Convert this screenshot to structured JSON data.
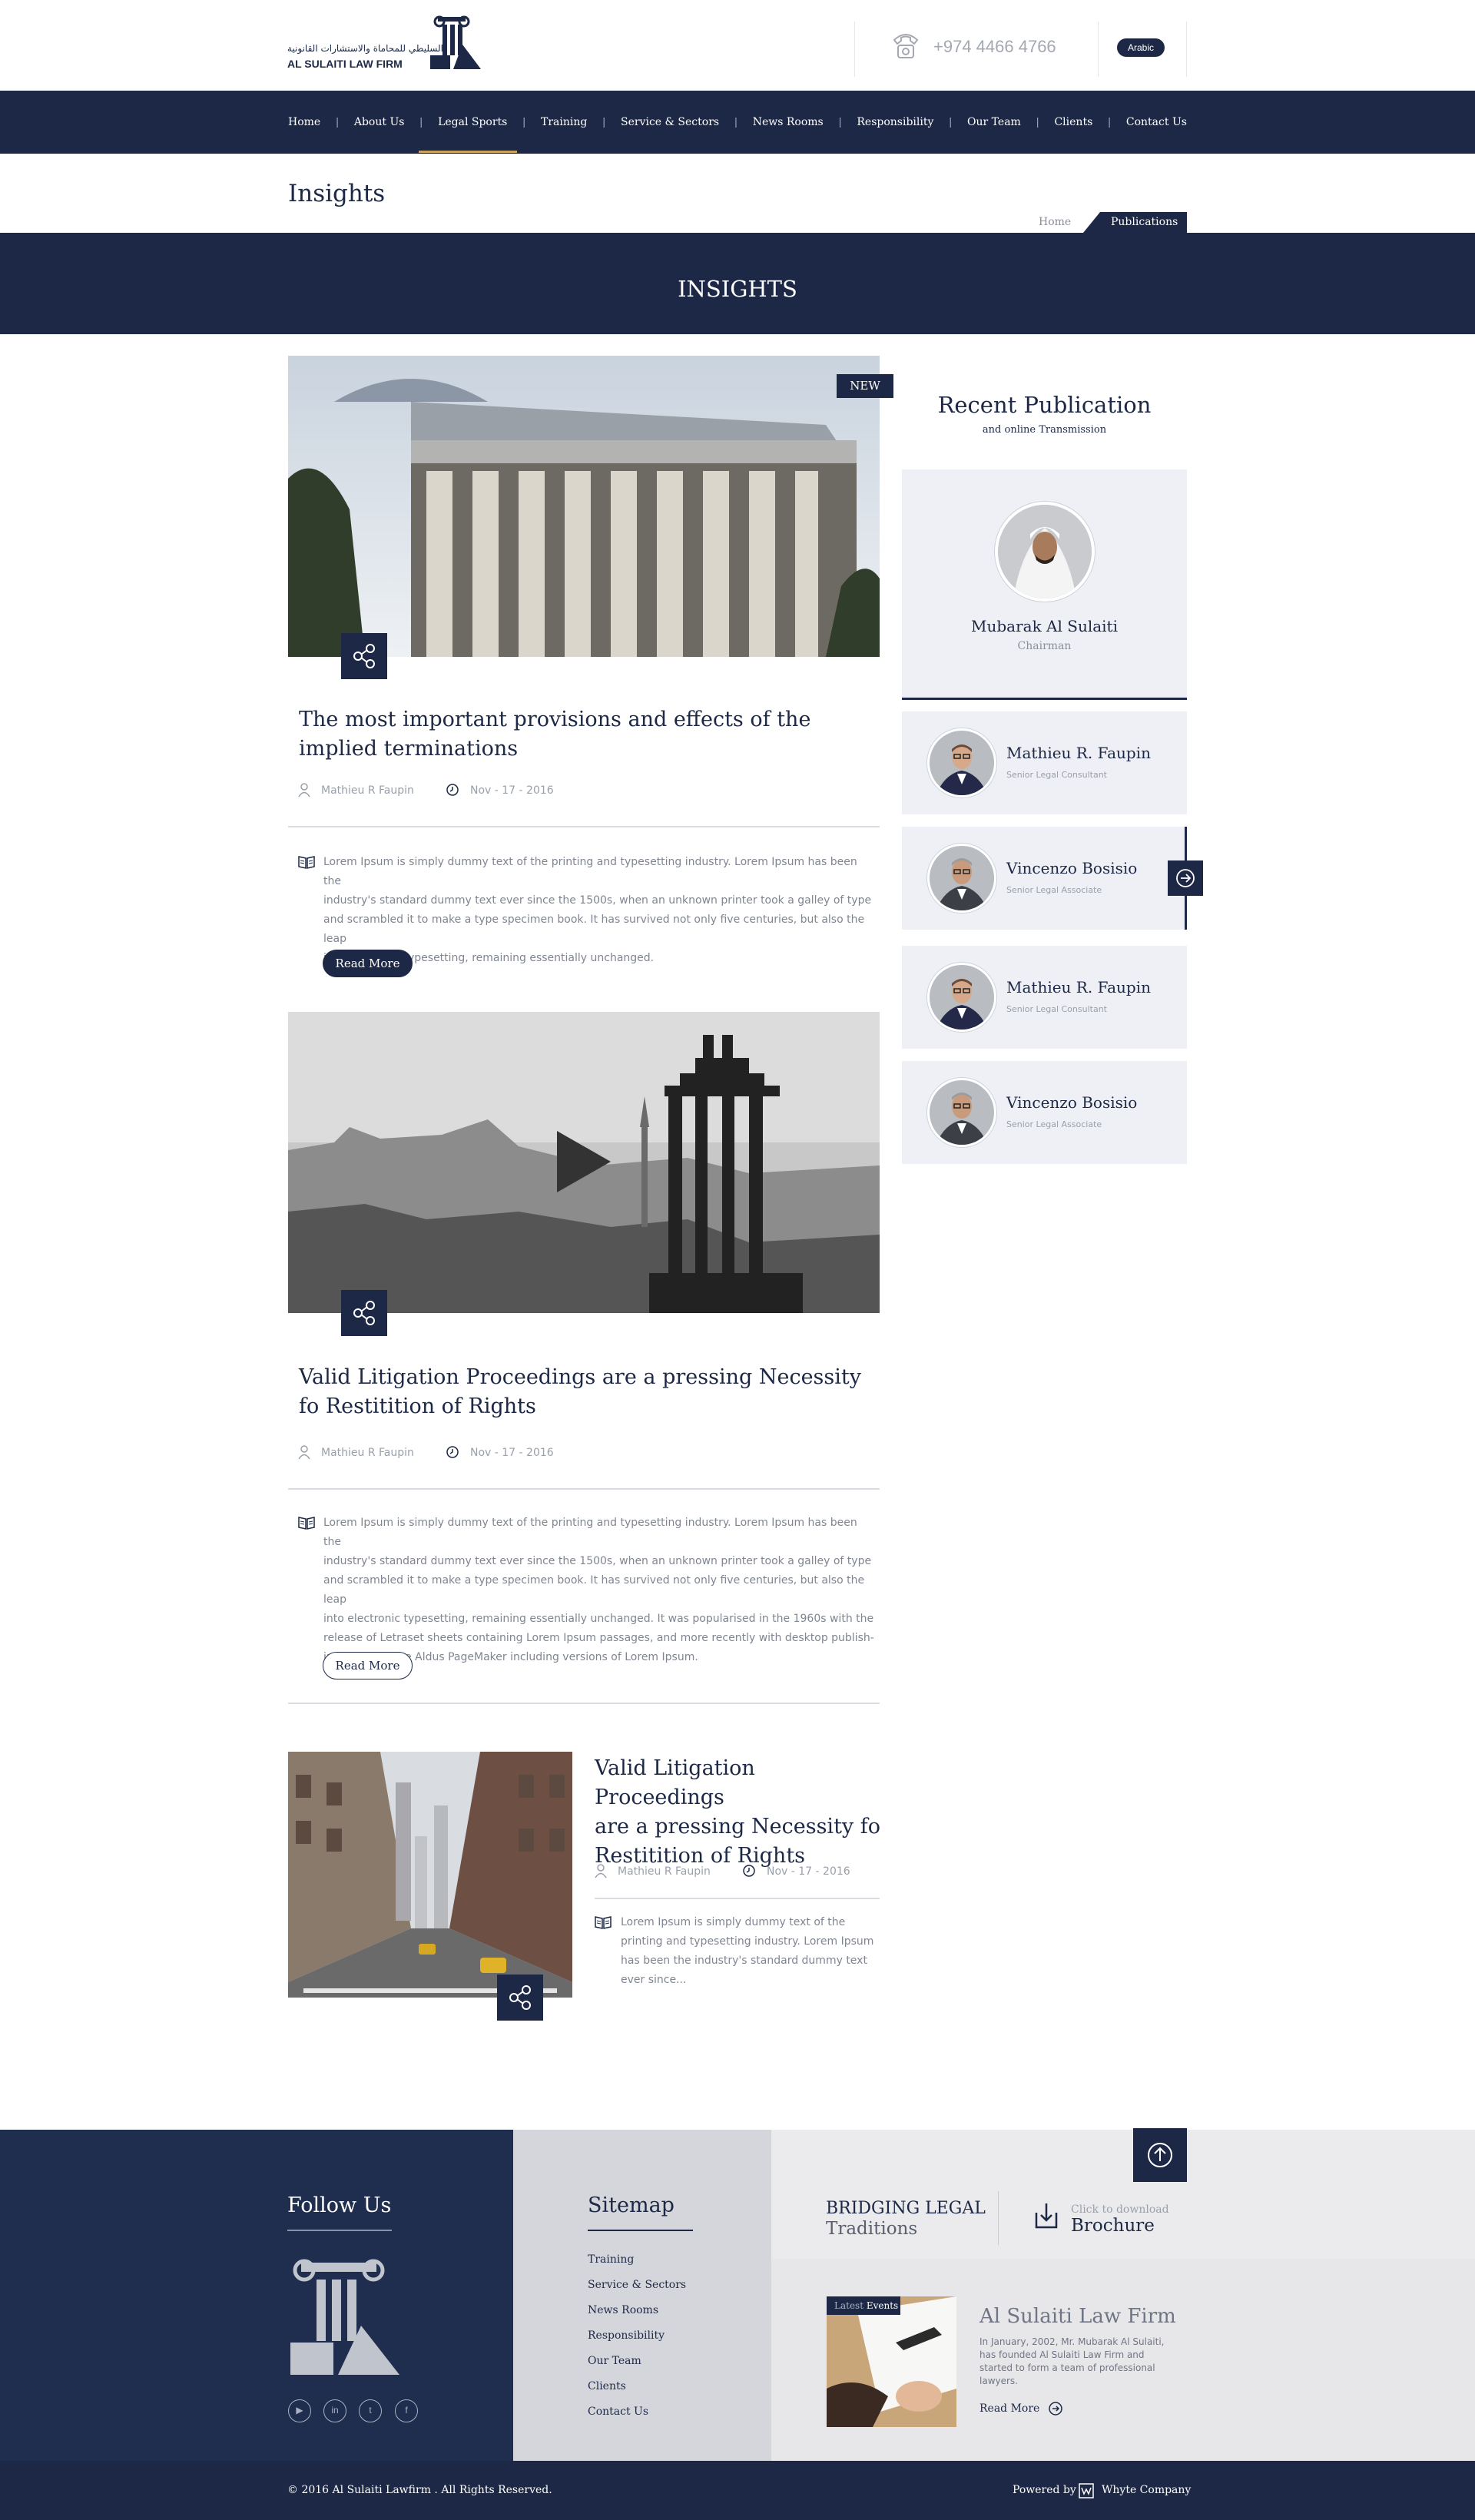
{
  "header": {
    "logo_arabic": "السليطي للمحاماة والاستشارات القانونية",
    "logo_name": "AL SULAITI LAW FIRM",
    "phone": "+974 4466 4766",
    "language_button": "Arabic"
  },
  "nav": {
    "items": [
      {
        "label": "Home"
      },
      {
        "label": "About Us"
      },
      {
        "label": "Legal Sports",
        "active": true
      },
      {
        "label": "Training"
      },
      {
        "label": "Service & Sectors"
      },
      {
        "label": "News Rooms"
      },
      {
        "label": "Responsibility"
      },
      {
        "label": "Our Team"
      },
      {
        "label": "Clients"
      },
      {
        "label": "Contact Us"
      }
    ],
    "separator": "|"
  },
  "page": {
    "title": "Insights",
    "breadcrumb": {
      "home": "Home",
      "current": "Publications"
    },
    "banner": "INSIGHTS"
  },
  "articles": [
    {
      "badge": "NEW",
      "title": "The most important provisions and effects of the implied terminations",
      "author": "Mathieu R Faupin",
      "date": "Nov - 17 - 2016",
      "body": [
        "Lorem Ipsum is simply dummy text of the printing and typesetting industry. Lorem Ipsum has been the",
        "industry's standard dummy text ever since the 1500s, when an unknown printer took a galley of type",
        "and scrambled it to make a type specimen book. It has survived not only five centuries, but also the leap",
        "into electronic typesetting, remaining essentially unchanged."
      ],
      "read_more": "Read More"
    },
    {
      "title": "Valid Litigation Proceedings are a pressing Necessity fo Restitition of Rights",
      "author": "Mathieu R Faupin",
      "date": "Nov - 17 - 2016",
      "body": [
        "Lorem Ipsum is simply dummy text of the printing and typesetting industry. Lorem Ipsum has been the",
        "industry's standard dummy text ever since the 1500s, when an unknown printer took a galley of type",
        "and scrambled it to make a type specimen book. It has survived not only five centuries, but also the leap",
        "into electronic typesetting, remaining essentially unchanged. It was popularised in the 1960s with the",
        "release of Letraset sheets containing Lorem Ipsum passages, and more recently with desktop publish-",
        "ing software like Aldus PageMaker including versions of Lorem Ipsum."
      ],
      "read_more": "Read More"
    },
    {
      "title_lines": [
        "Valid Litigation Proceedings",
        "are a pressing Necessity fo",
        "Restitition of Rights"
      ],
      "author": "Mathieu R Faupin",
      "date": "Nov - 17 - 2016",
      "body": [
        "Lorem Ipsum is simply dummy text of the",
        "printing and typesetting industry. Lorem Ipsum",
        "has been the industry's standard dummy text",
        "ever since..."
      ]
    }
  ],
  "sidebar": {
    "title": "Recent Publication",
    "subtitle": "and online Transmission",
    "chairman": {
      "name": "Mubarak Al Sulaiti",
      "role": "Chairman"
    },
    "members": [
      {
        "name": "Mathieu R. Faupin",
        "role": "Senior Legal Consultant"
      },
      {
        "name": "Vincenzo Bosisio",
        "role": "Senior Legal Associate"
      },
      {
        "name": "Mathieu R. Faupin",
        "role": "Senior Legal Consultant"
      },
      {
        "name": "Vincenzo Bosisio",
        "role": "Senior Legal Associate"
      }
    ]
  },
  "footer": {
    "follow_title": "Follow Us",
    "social": [
      "youtube-icon",
      "linkedin-icon",
      "twitter-icon",
      "facebook-icon"
    ],
    "sitemap_title": "Sitemap",
    "sitemap_links": [
      "Training",
      "Service & Sectors",
      "News Rooms",
      "Responsibility",
      "Our Team",
      "Clients",
      "Contact Us"
    ],
    "bridging_line1": "BRIDGING LEGAL",
    "bridging_line2": "Traditions",
    "download_small": "Click to download",
    "download_big": "Brochure",
    "event_badge_a": "Latest",
    "event_badge_b": "Events",
    "event_title": "Al Sulaiti Law Firm",
    "event_text": "In January, 2002, Mr. Mubarak Al Sulaiti, has founded Al Sulaiti Law Firm and started to form a team of professional lawyers.",
    "event_more": "Read More",
    "copyright": "© 2016 Al Sulaiti Lawfirm . All Rights Reserved.",
    "powered": "Powered by",
    "company": "Whyte Company"
  },
  "colors": {
    "navy": "#1c2845",
    "gold": "#c9a257",
    "light": "#eef0f5"
  }
}
